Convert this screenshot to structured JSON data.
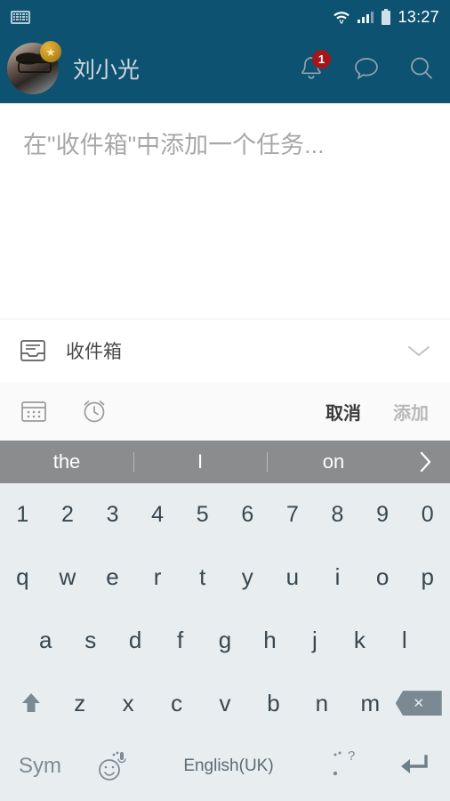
{
  "statusbar": {
    "keyboard_icon": "keyboard-icon",
    "wifi_icon": "wifi-icon",
    "signal_icon": "cellular-signal-icon",
    "battery_icon": "battery-icon",
    "time": "13:27"
  },
  "header": {
    "avatar_icon": "user-avatar",
    "badge_icon": "star-badge-icon",
    "username": "刘小光",
    "notification_icon": "bell-icon",
    "notification_count": "1",
    "message_icon": "chat-bubble-icon",
    "search_icon": "search-icon",
    "background_color": "#0d5271"
  },
  "compose": {
    "placeholder": "在\"收件箱\"中添加一个任务...",
    "value": ""
  },
  "project": {
    "icon": "inbox-icon",
    "name": "收件箱",
    "chevron_icon": "chevron-down-icon"
  },
  "toolbar": {
    "calendar_icon": "calendar-icon",
    "reminder_icon": "alarm-clock-icon",
    "cancel_label": "取消",
    "add_label": "添加"
  },
  "keyboard": {
    "suggestions": [
      "the",
      "I",
      "on"
    ],
    "more_icon": "chevron-right-icon",
    "suggestion_bar_color": "#8a8c8e",
    "background_color": "#e8edf0",
    "rows": {
      "numbers": [
        "1",
        "2",
        "3",
        "4",
        "5",
        "6",
        "7",
        "8",
        "9",
        "0"
      ],
      "top": [
        "q",
        "w",
        "e",
        "r",
        "t",
        "y",
        "u",
        "i",
        "o",
        "p"
      ],
      "home": [
        "a",
        "s",
        "d",
        "f",
        "g",
        "h",
        "j",
        "k",
        "l"
      ],
      "bottom": [
        "z",
        "x",
        "c",
        "v",
        "b",
        "n",
        "m"
      ]
    },
    "shift_icon": "shift-icon",
    "backspace_icon": "backspace-icon",
    "sym_label": "Sym",
    "emoji_icon": "emoji-mic-icon",
    "space_label": "English(UK)",
    "punct_label": ".",
    "punct_alt_label": "?",
    "enter_icon": "enter-icon"
  }
}
